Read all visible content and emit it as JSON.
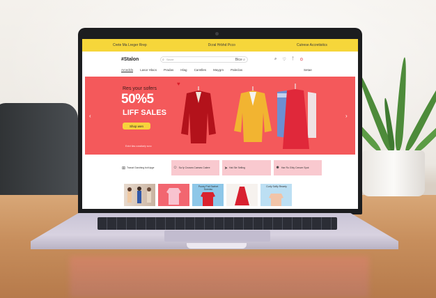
{
  "topbar": {
    "left": "Crete Ma Lreger Rrep",
    "center": "Dcral Hrbhd Pcco",
    "right": "Cutrese Accretisitcs"
  },
  "header": {
    "logo": "#Stalon",
    "search_placeholder": "Secre",
    "search_button": "Btce",
    "icons": [
      "search-icon",
      "wishlist-icon",
      "account-icon",
      "cart-icon"
    ]
  },
  "nav": {
    "items": [
      "Arcedcls",
      "Lasor Hlacs",
      "Pradas",
      "Hlag",
      "Camtlles",
      "Maygrn",
      "Paleclas"
    ],
    "right": "Setae"
  },
  "hero": {
    "subtitle": "Res your sofers",
    "headline": "50%5",
    "sales": "LIFF SALES",
    "button": "Shop wen",
    "footer": "Extvt tlas cussitarly scvc"
  },
  "features": [
    {
      "label": "Tranat Garching bcit tpge",
      "icon": "gift-icon"
    },
    {
      "label": "Sa fy Cnoses Caeses Calere",
      "icon": "person-icon"
    },
    {
      "label": "Hat Sie Selling",
      "icon": "tag-icon"
    },
    {
      "label": "Har Ro Ghly Cencer Spot",
      "icon": "person-icon"
    }
  ],
  "thumbs": [
    {
      "label": ""
    },
    {
      "label": ""
    },
    {
      "label": "Pucey Puti Ssehet Scentsc"
    },
    {
      "label": ""
    },
    {
      "label": "Curfy Scfily Reaety"
    }
  ],
  "colors": {
    "accent_yellow": "#f6d63a",
    "hero_red": "#f4595b",
    "pink": "#f9c9cf"
  }
}
